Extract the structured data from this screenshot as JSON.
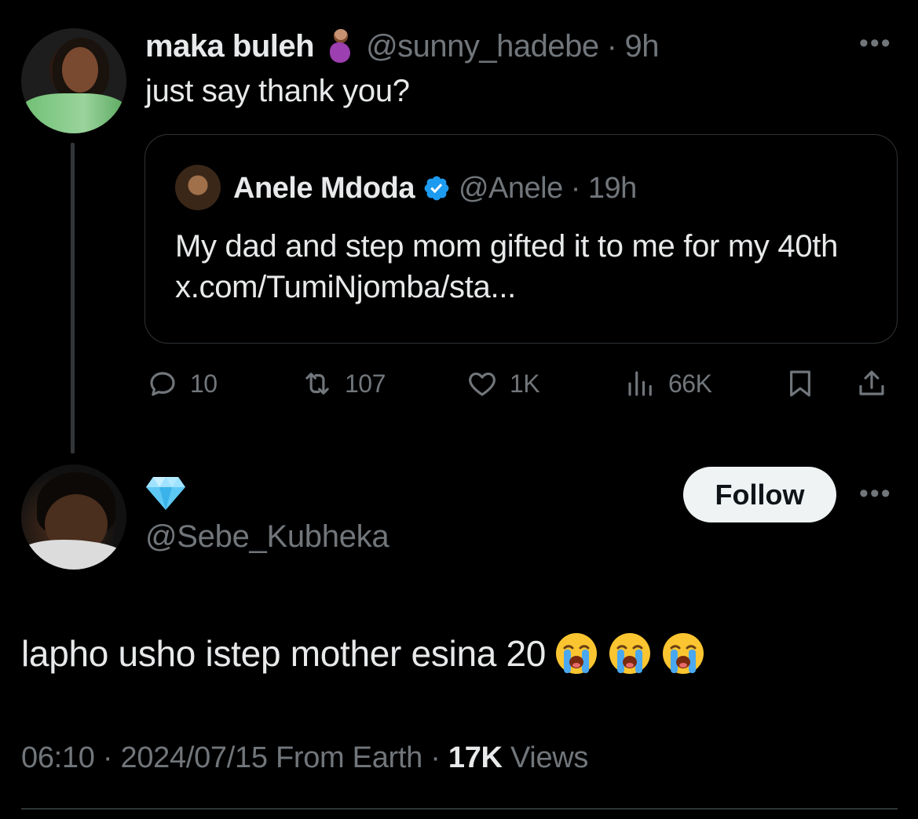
{
  "parent_tweet": {
    "display_name": "maka buleh",
    "name_emoji_icon": "pregnant-woman-icon",
    "handle": "@sunny_hadebe",
    "time": "9h",
    "text": "just say thank you?",
    "more_icon": "more-dots-icon"
  },
  "quoted_tweet": {
    "display_name": "Anele Mdoda",
    "verified_icon": "verified-badge-icon",
    "handle": "@Anele",
    "time": "19h",
    "text": "My dad and step mom gifted it to me for my 40th x.com/TumiNjomba/sta..."
  },
  "actions": {
    "replies": "10",
    "reposts": "107",
    "likes": "1K",
    "views": "66K"
  },
  "reply_tweet": {
    "display_name_icon": "gem-icon",
    "handle": "@Sebe_Kubheka",
    "follow_label": "Follow",
    "text": "lapho usho istep mother esina 20",
    "text_emojis": [
      "loudly-crying-face-icon",
      "loudly-crying-face-icon",
      "loudly-crying-face-icon"
    ],
    "time": "06:10",
    "date": "2024/07/15",
    "source": "From Earth",
    "view_count": "17K",
    "views_label": "Views"
  },
  "colors": {
    "background": "#000000",
    "text_primary": "#e7e9ea",
    "text_secondary": "#71767b",
    "verified_blue": "#1d9bf0",
    "border": "#2f3336"
  }
}
